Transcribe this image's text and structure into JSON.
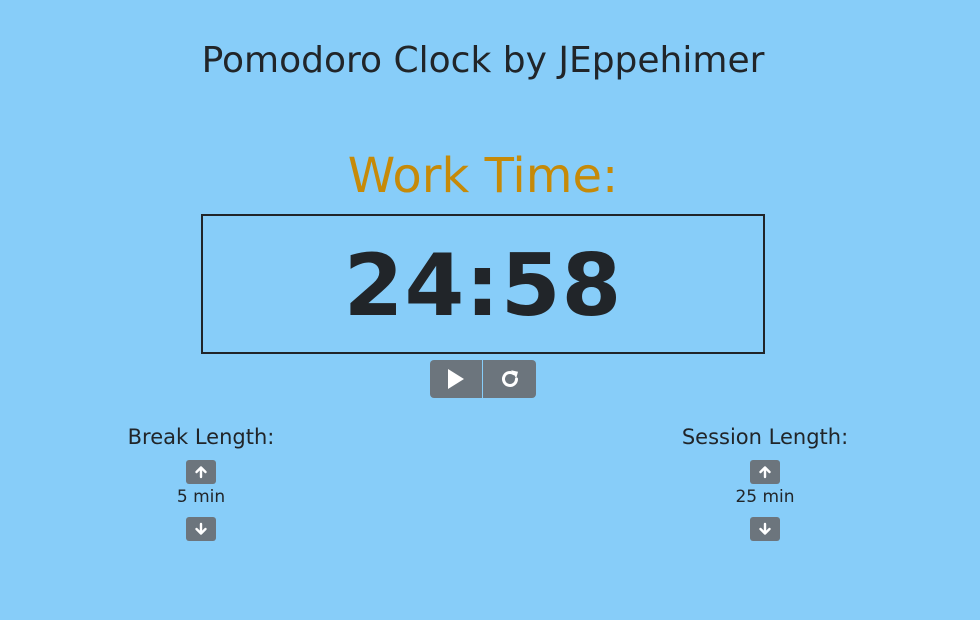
{
  "header": {
    "title": "Pomodoro Clock by JEppehimer"
  },
  "timer": {
    "mode_label": "Work Time:",
    "display": "24:58"
  },
  "controls": {
    "play_icon": "play-icon",
    "reset_icon": "reset-icon"
  },
  "break_setting": {
    "label": "Break Length:",
    "value": "5 min"
  },
  "session_setting": {
    "label": "Session Length:",
    "value": "25 min"
  },
  "colors": {
    "background": "#87cdf9",
    "mode_label": "#c68a08",
    "button": "#6c757d",
    "text": "#212529"
  }
}
